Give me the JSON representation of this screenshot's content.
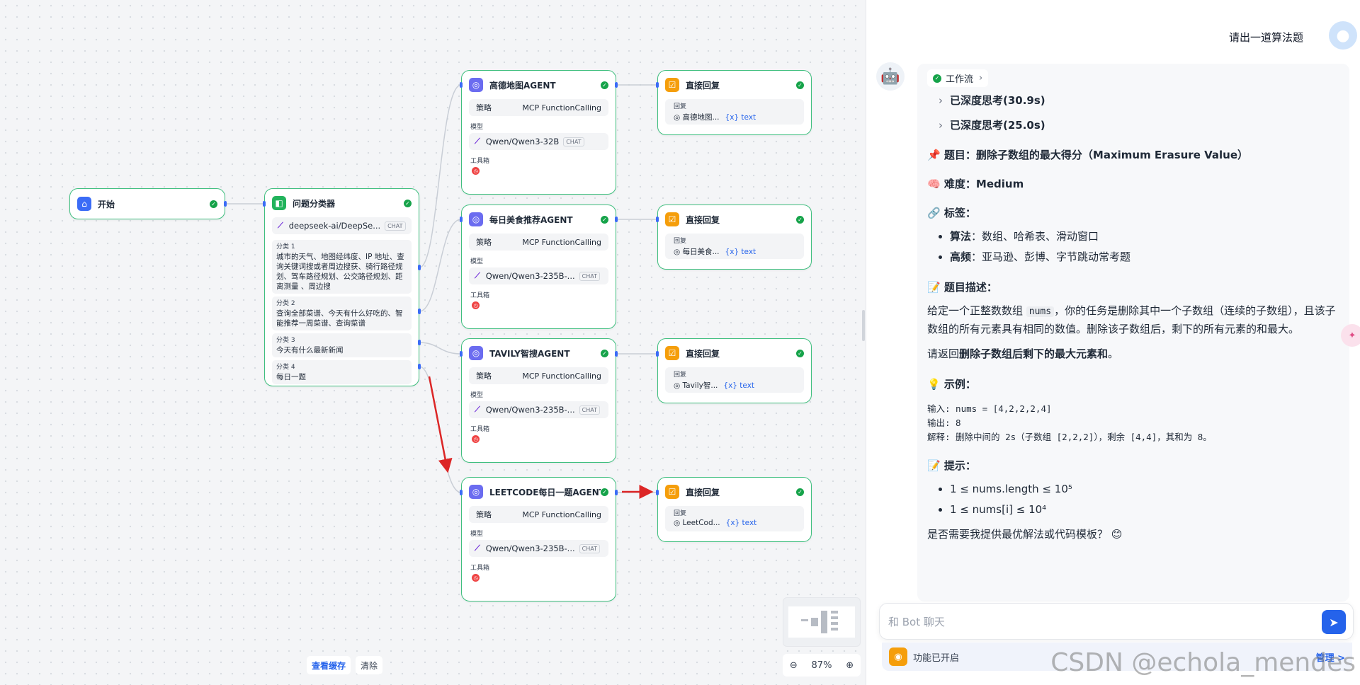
{
  "canvas": {
    "start": {
      "title": "开始"
    },
    "classifier": {
      "title": "问题分类器",
      "model": "deepseek-ai/DeepSe...",
      "chat_tag": "CHAT",
      "classes": [
        {
          "title": "分类 1",
          "text": "城市的天气、地图经纬度、IP 地址、查询关键词搜或者周边搜获、骑行路径规划、驾车路径规划、公交路径规划、距离测量 、周边搜"
        },
        {
          "title": "分类 2",
          "text": "查询全部菜谱、今天有什么好吃的、智能推荐一周菜谱、查询菜谱"
        },
        {
          "title": "分类 3",
          "text": "今天有什么最新新闻"
        },
        {
          "title": "分类 4",
          "text": "每日一题"
        }
      ]
    },
    "agents": [
      {
        "title": "高德地图AGENT",
        "strategy_label": "策略",
        "strategy": "MCP FunctionCalling",
        "model_label": "模型",
        "model": "Qwen/Qwen3-32B",
        "chat_tag": "CHAT",
        "tools_label": "工具箱"
      },
      {
        "title": "每日美食推荐AGENT",
        "strategy_label": "策略",
        "strategy": "MCP FunctionCalling",
        "model_label": "模型",
        "model": "Qwen/Qwen3-235B-...",
        "chat_tag": "CHAT",
        "tools_label": "工具箱"
      },
      {
        "title": "TAVILY智搜AGENT",
        "strategy_label": "策略",
        "strategy": "MCP FunctionCalling",
        "model_label": "模型",
        "model": "Qwen/Qwen3-235B-...",
        "chat_tag": "CHAT",
        "tools_label": "工具箱"
      },
      {
        "title": "LEETCODE每日一题AGENT",
        "strategy_label": "策略",
        "strategy": "MCP FunctionCalling",
        "model_label": "模型",
        "model": "Qwen/Qwen3-235B-...",
        "chat_tag": "CHAT",
        "tools_label": "工具箱"
      }
    ],
    "replies": [
      {
        "title": "直接回复",
        "label": "回复",
        "source": "高德地图...",
        "var": "{x} text"
      },
      {
        "title": "直接回复",
        "label": "回复",
        "source": "每日美食...",
        "var": "{x} text"
      },
      {
        "title": "直接回复",
        "label": "回复",
        "source": "Tavily智...",
        "var": "{x} text"
      },
      {
        "title": "直接回复",
        "label": "回复",
        "source": "LeetCod...",
        "var": "{x} text"
      }
    ],
    "bottom": {
      "view_cache": "查看缓存",
      "clear": "清除"
    },
    "zoom": "87%"
  },
  "chat": {
    "user_message": "请出一道算法题",
    "workflow_chip": "工作流",
    "thinking": [
      "已深度思考(30.9s)",
      "已深度思考(25.0s)"
    ],
    "title_prefix": "📌 题目：",
    "title": "删除子数组的最大得分（Maximum Erasure Value）",
    "difficulty_prefix": "🧠 难度：",
    "difficulty": "Medium",
    "tags_heading": "🔗 标签：",
    "tags": [
      {
        "key": "算法",
        "value": "：数组、哈希表、滑动窗口"
      },
      {
        "key": "高频",
        "value": "：亚马逊、彭博、字节跳动常考题"
      }
    ],
    "desc_heading": "📝 题目描述：",
    "desc_1": "给定一个正整数数组 ",
    "desc_code": "nums",
    "desc_2": "，你的任务是删除其中一个子数组（连续的子数组），且该子数组的所有元素具有相同的数值。删除该子数组后，剩下的所有元素的和最大。",
    "return_1": "请返回",
    "return_bold": "删除子数组后剩下的最大元素和",
    "return_2": "。",
    "example_heading": "💡 示例：",
    "example": "输入: nums = [4,2,2,2,4]\n输出: 8\n解释: 删除中间的 2s（子数组 [2,2,2]），剩余 [4,4]，其和为 8。",
    "hint_heading": "📝 提示：",
    "hints": [
      "1 ≤ nums.length ≤ 10⁵",
      "1 ≤ nums[i] ≤ 10⁴"
    ],
    "closing": "是否需要我提供最优解法或代码模板？ 😊",
    "input_placeholder": "和 Bot 聊天",
    "feature_status": "功能已开启",
    "manage": "管理 >"
  },
  "watermark": "CSDN @echola_mendes",
  "colors": {
    "node_border": "#3fbf7f",
    "accent": "#2563eb",
    "arrow": "#dc2626"
  }
}
